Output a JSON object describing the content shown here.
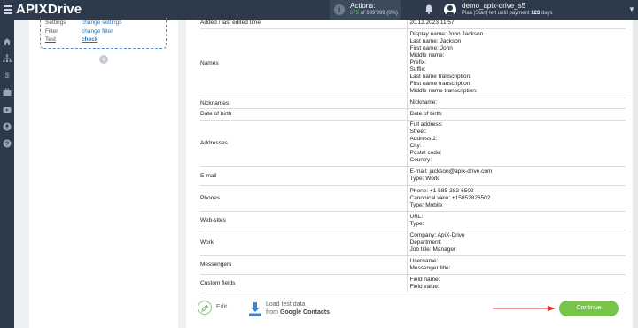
{
  "app": {
    "logo_prefix": "API",
    "logo_x": "X",
    "logo_suffix": "Drive"
  },
  "header": {
    "actions_label": "Actions:",
    "actions_used": "273",
    "actions_total": "of 999'999",
    "actions_pct": "(0%)",
    "username": "demo_apix-drive_s5",
    "plan_prefix": "Plan |Start| left until payment",
    "plan_days": "123",
    "plan_suffix": "days"
  },
  "sidebar": {
    "items": [
      "home-icon",
      "sitemap-icon",
      "dollar-icon",
      "briefcase-icon",
      "video-icon",
      "user-icon",
      "help-icon"
    ]
  },
  "left_panel": {
    "rows": [
      {
        "key": "Settings",
        "link": "change settings"
      },
      {
        "key": "Filter",
        "link": "change filter"
      },
      {
        "key": "Test",
        "link": "check"
      }
    ]
  },
  "table": {
    "rows": [
      {
        "key": "Added / last edited time",
        "values": [
          "20.12.2023 11:57"
        ]
      },
      {
        "key": "Names",
        "values": [
          "Display name: John Jackson",
          "Last name: Jackson",
          "First name: John",
          "Middle name:",
          "Prefix:",
          "Suffix:",
          "Last name transcription:",
          "First name transcription:",
          "Middle name transcription:"
        ]
      },
      {
        "key": "Nicknames",
        "values": [
          "Nickname:"
        ]
      },
      {
        "key": "Date of birth",
        "values": [
          "Date of birth:"
        ]
      },
      {
        "key": "Addresses",
        "values": [
          "Full address:",
          "Street:",
          "Address 2:",
          "City:",
          "Postal code:",
          "Country:"
        ]
      },
      {
        "key": "E-mail",
        "values": [
          "E-mail: jackson@apix-drive.com",
          "Type: Work"
        ]
      },
      {
        "key": "Phones",
        "values": [
          "Phone: +1 585-282-6502",
          "Canonical view: +15852826502",
          "Type: Mobile"
        ]
      },
      {
        "key": "Web-sites",
        "values": [
          "URL:",
          "Type:"
        ]
      },
      {
        "key": "Work",
        "values": [
          "Company: ApiX-Drive",
          "Department:",
          "Job title: Manager"
        ]
      },
      {
        "key": "Messengers",
        "values": [
          "Username:",
          "Messenger title:"
        ]
      },
      {
        "key": "Custom fields",
        "values": [
          "Field name:",
          "Field value:"
        ]
      }
    ]
  },
  "footer": {
    "edit_label": "Edit",
    "load_line1": "Load test data",
    "load_line2_prefix": "from",
    "load_line2_bold": "Google Contacts",
    "continue_label": "Continue"
  },
  "colors": {
    "topbar": "#2c3a4b",
    "accent_green": "#78c34a",
    "link_blue": "#3173b8",
    "arrow_red": "#d9322b"
  }
}
